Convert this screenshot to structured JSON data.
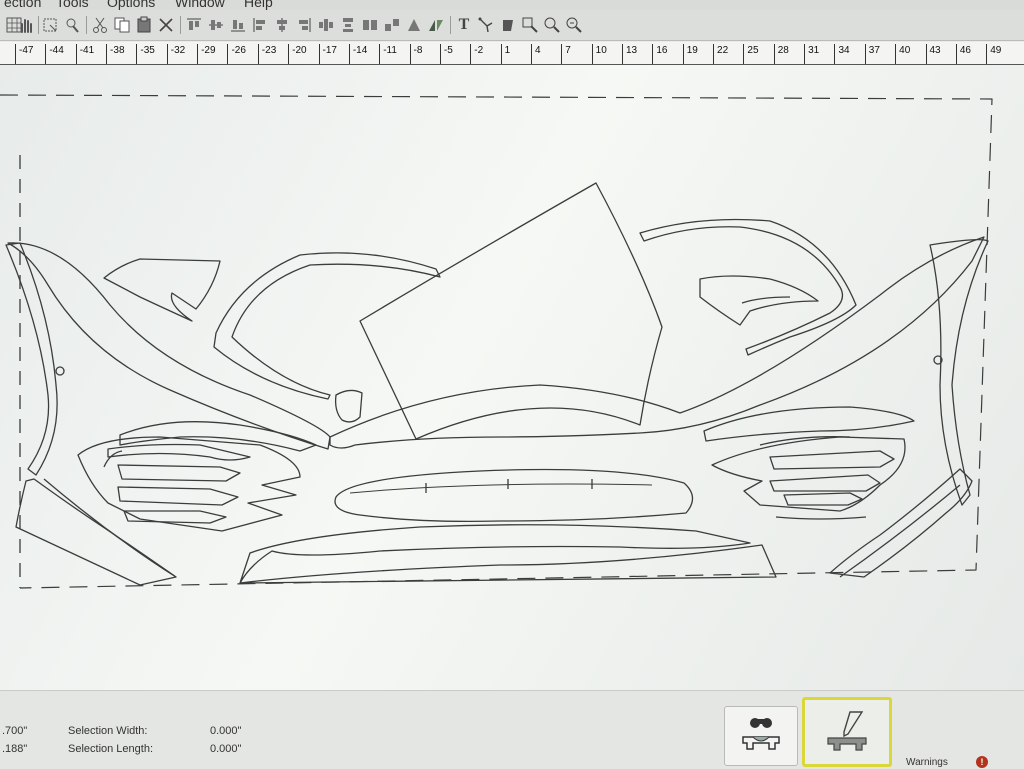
{
  "menu": {
    "items": [
      "ection",
      "Tools",
      "Options",
      "Window",
      "Help"
    ]
  },
  "toolbar": {
    "icons": [
      "grid-icon",
      "hand-pan-icon",
      "select-icon",
      "lasso-icon",
      "cut-icon",
      "copy-icon",
      "paste-icon",
      "delete-icon",
      "align-top-icon",
      "align-middle-icon",
      "align-bottom-icon",
      "align-left-icon",
      "align-center-icon",
      "align-right-icon",
      "distribute-icon",
      "mirror-icon",
      "text-icon",
      "node-edit-icon",
      "weed-icon",
      "zoom-in-icon",
      "zoom-out-icon",
      "zoom-fit-icon"
    ],
    "text_tool_glyph": "T"
  },
  "ruler": {
    "labels": [
      "-47",
      "-44",
      "-41",
      "-38",
      "-35",
      "-32",
      "-29",
      "-26",
      "-23",
      "-20",
      "-17",
      "-14",
      "-11",
      "-8",
      "-5",
      "-2",
      "1",
      "4",
      "7",
      "10",
      "13",
      "16",
      "19",
      "22",
      "25",
      "28",
      "31",
      "34",
      "37",
      "40",
      "43",
      "46",
      "49"
    ]
  },
  "status": {
    "left_value_1": ".700\"",
    "left_value_2": ".188\"",
    "selection_width_label": "Selection Width:",
    "selection_width_value": "0.000\"",
    "selection_length_label": "Selection Length:",
    "selection_length_value": "0.000\"",
    "warnings_label": "Warnings",
    "warning_badge": "!"
  },
  "buttons": {
    "layout_label": "",
    "edit_label": ""
  },
  "colors": {
    "canvas_bg": "#eef1ee",
    "outline": "#3a3d3c",
    "dash_red": "#c0392b",
    "active_border": "#d9d73a"
  }
}
